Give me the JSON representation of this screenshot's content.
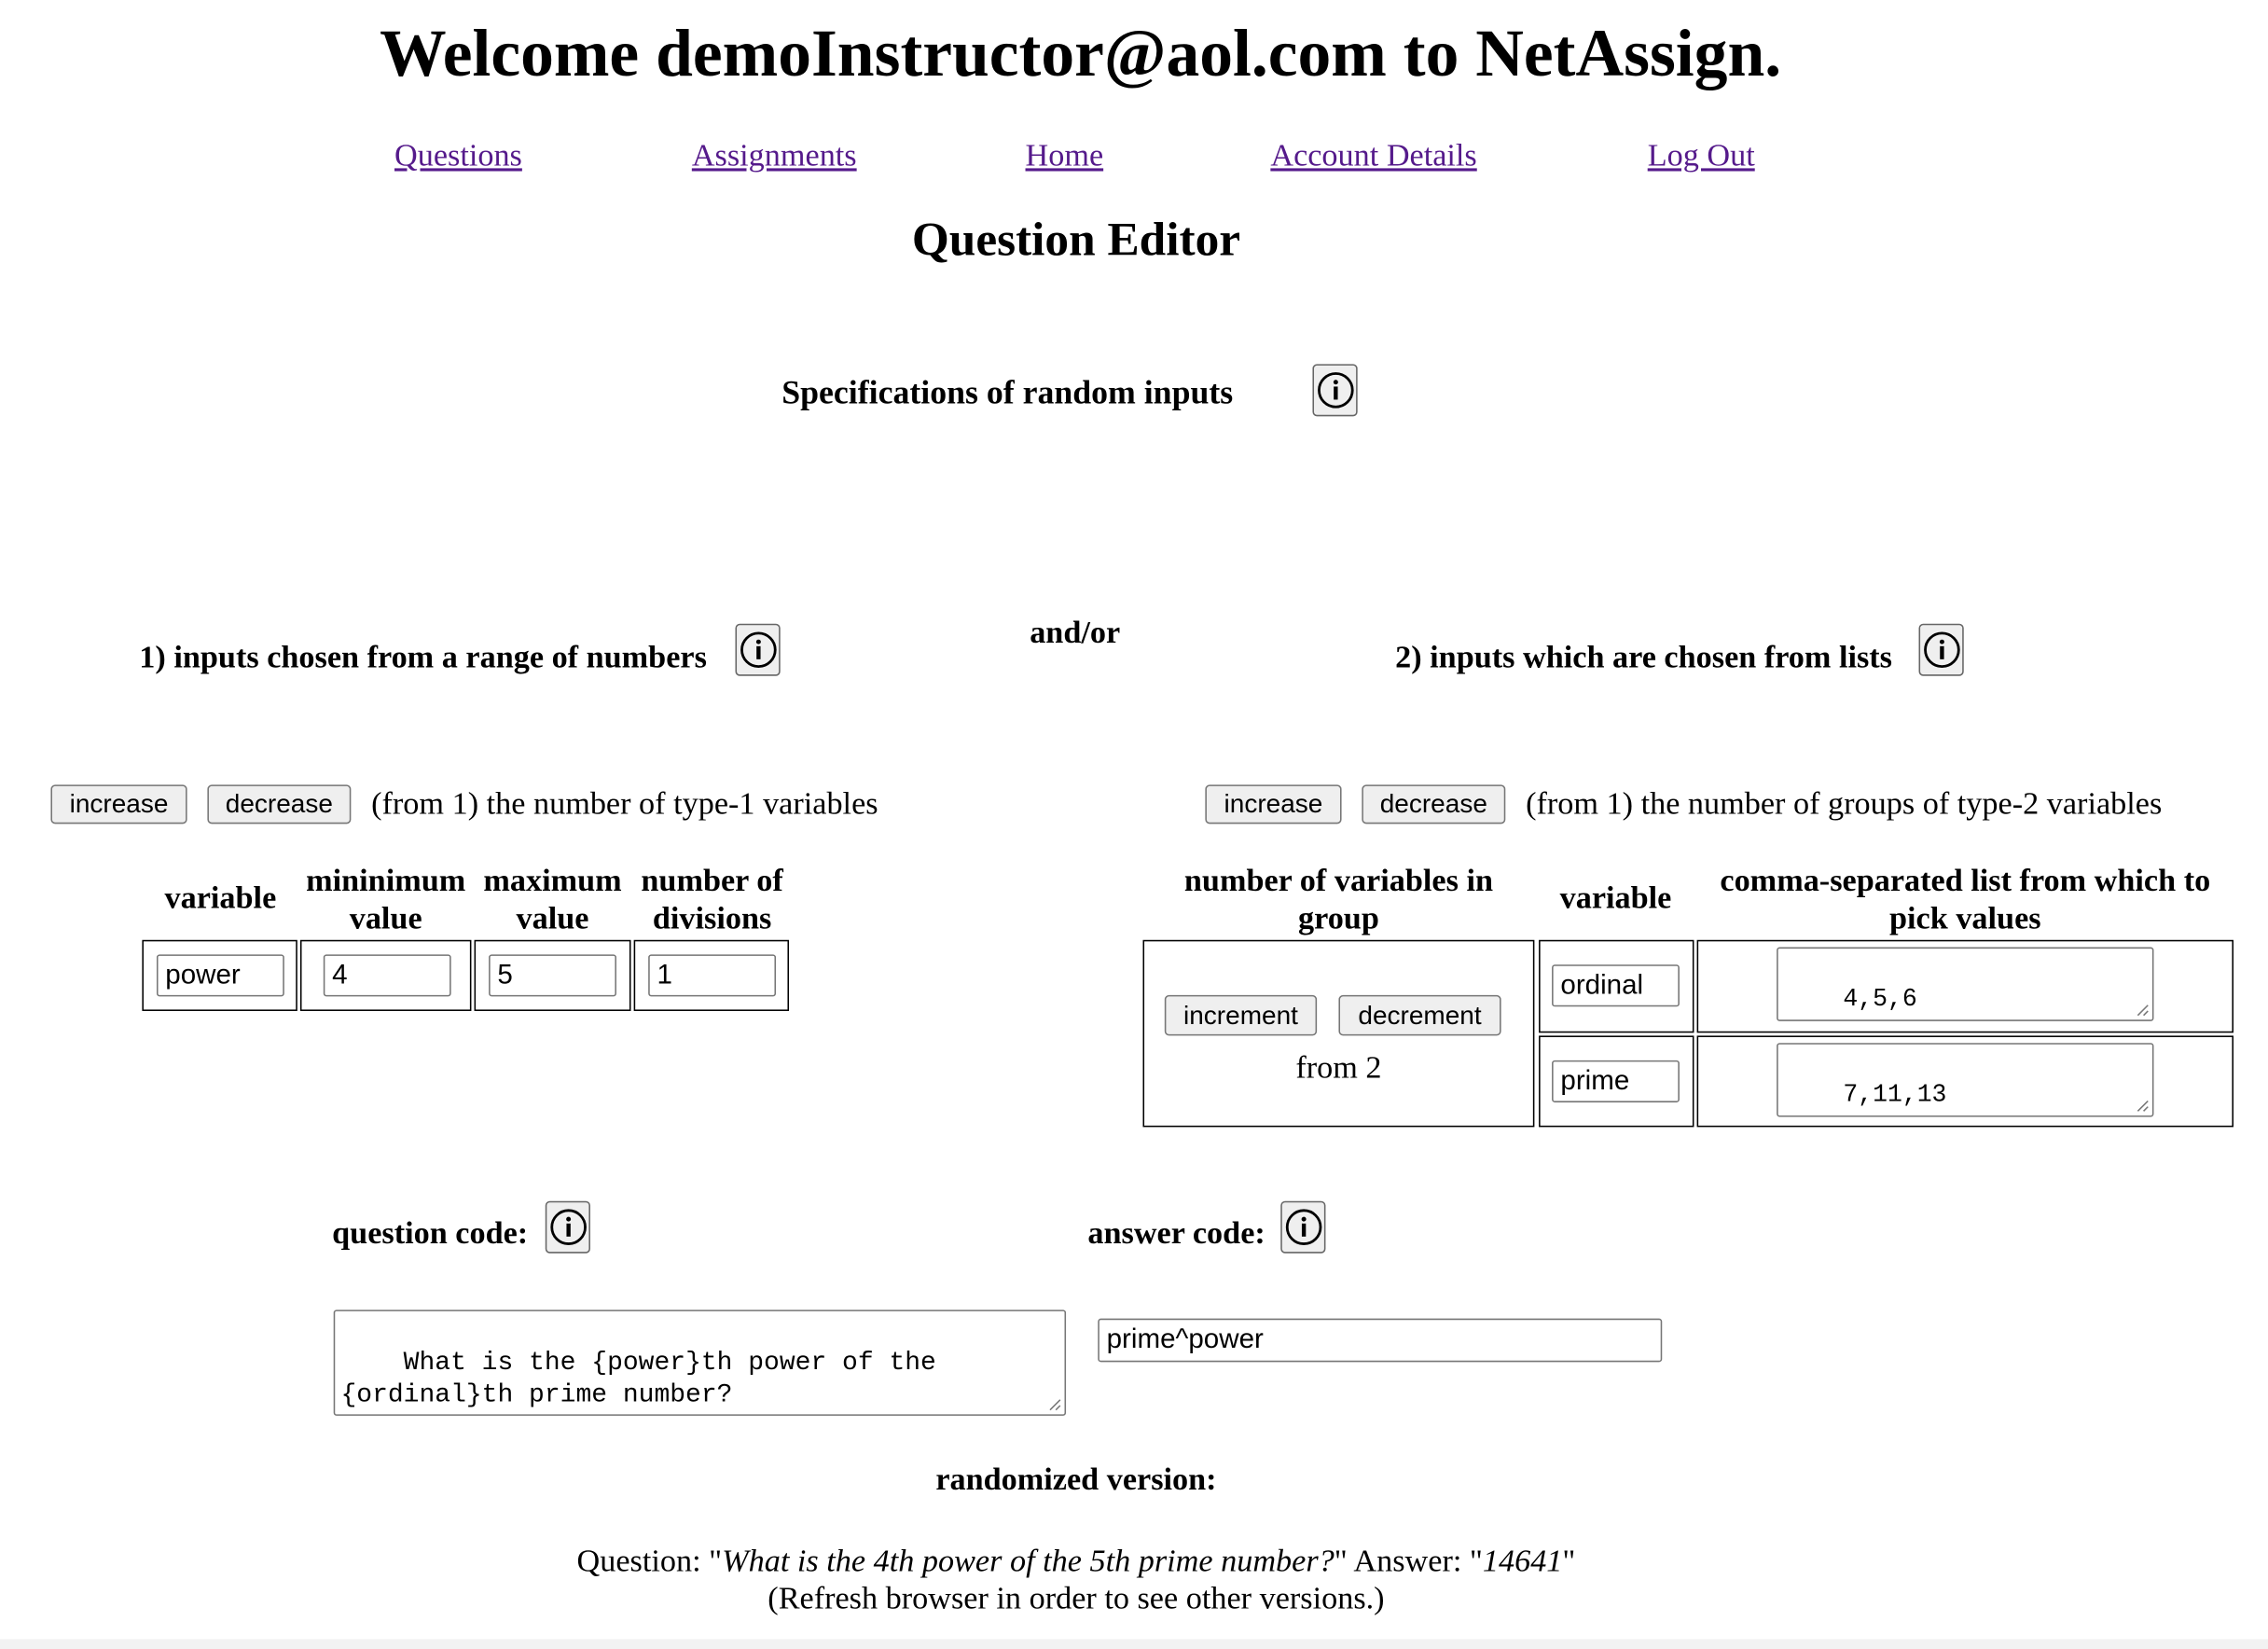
{
  "header": {
    "welcome": "Welcome demoInstructor@aol.com to NetAssign."
  },
  "nav": {
    "questions": "Questions",
    "assignments": "Assignments",
    "home": "Home",
    "account_details": "Account Details",
    "log_out": "Log Out"
  },
  "page_title": "Question Editor",
  "specs": {
    "heading": "Specifications of random inputs",
    "and_or": "and/or",
    "range": {
      "heading": "1) inputs chosen from a range of numbers",
      "increase": "increase",
      "decrease": "decrease",
      "caption": "(from 1) the number of type-1 variables",
      "headers": {
        "variable": "variable",
        "min_line1": "mininimum",
        "min_line2": "value",
        "max_line1": "maximum",
        "max_line2": "value",
        "div_line1": "number of",
        "div_line2": "divisions"
      },
      "rows": [
        {
          "variable": "power",
          "min": "4",
          "max": "5",
          "divisions": "1"
        }
      ]
    },
    "lists": {
      "heading": "2) inputs which are chosen from lists",
      "increase": "increase",
      "decrease": "decrease",
      "caption": "(from 1) the number of groups of type-2 variables",
      "headers": {
        "count_line1": "number of variables in",
        "count_line2": "group",
        "variable": "variable",
        "list_line1": "comma-separated list from which to",
        "list_line2": "pick values"
      },
      "group": {
        "increment": "increment",
        "decrement": "decrement",
        "from": "from 2"
      },
      "rows": [
        {
          "variable": "ordinal",
          "values": "4,5,6"
        },
        {
          "variable": "prime",
          "values": "7,11,13"
        }
      ]
    }
  },
  "code": {
    "question_label": "question code:",
    "answer_label": "answer code:",
    "question_value": "What is the {power}th power of the {ordinal}th prime number?",
    "answer_value": "prime^power"
  },
  "randomized": {
    "heading": "randomized version:",
    "question_prefix": "Question: \"",
    "question_text": "What is the 4th power of the 5th prime number?",
    "answer_prefix": "\" Answer: \"",
    "answer_text": "14641",
    "answer_suffix": "\"",
    "note": "(Refresh browser in order to see other versions.)"
  },
  "icons": {
    "info": "info-icon"
  }
}
